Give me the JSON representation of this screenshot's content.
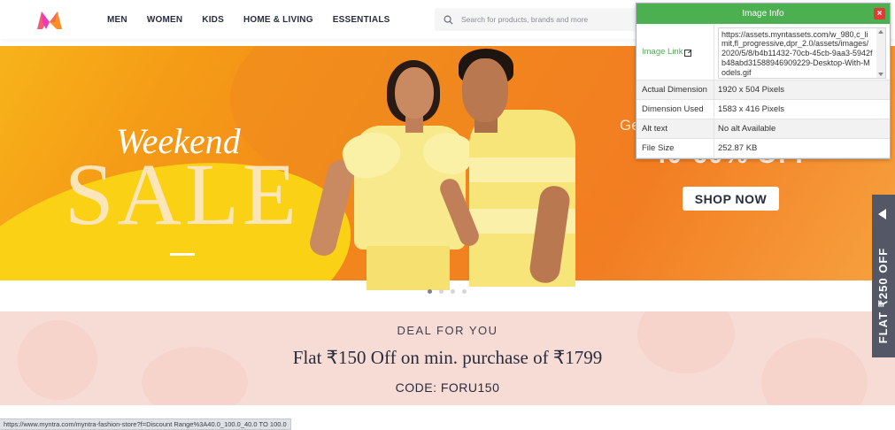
{
  "header": {
    "nav": [
      "MEN",
      "WOMEN",
      "KIDS",
      "HOME & LIVING",
      "ESSENTIALS"
    ],
    "search_placeholder": "Search for products, brands and more"
  },
  "banner": {
    "weekend": "Weekend",
    "sale": "SALE",
    "offer_partial": "Ge",
    "offer_big": "40-60% OFF",
    "shop_now": "SHOP NOW"
  },
  "carousel": {
    "count": 4,
    "active": 1
  },
  "deal": {
    "kicker": "DEAL FOR YOU",
    "title": "Flat ₹150 Off on min. purchase of ₹1799",
    "code": "CODE: FORU150"
  },
  "side_tab": {
    "label": "FLAT ₹250 OFF"
  },
  "status_bar": {
    "url": "https://www.myntra.com/myntra-fashion-store?f=Discount Range%3A40.0_100.0_40.0 TO 100.0"
  },
  "image_info": {
    "title": "Image Info",
    "close": "×",
    "image_link_label": "Image Link",
    "image_link_value": "https://assets.myntassets.com/w_980,c_limit,fl_progressive,dpr_2.0/assets/images/2020/5/8/b4b11432-70cb-45cb-9aa3-5942fb48abd31588946909229-Desktop-With-Models.gif",
    "actual_dimension_label": "Actual Dimension",
    "actual_dimension_value": "1920 x 504 Pixels",
    "dimension_used_label": "Dimension Used",
    "dimension_used_value": "1583 x 416 Pixels",
    "alt_text_label": "Alt text",
    "alt_text_value": "No alt Available",
    "file_size_label": "File Size",
    "file_size_value": "252.87 KB"
  },
  "colors": {
    "brand_pink": "#ff3f6c",
    "brand_orange": "#f7a23f",
    "popup_green": "#4caf50",
    "deal_bg": "#f7dcd6"
  }
}
